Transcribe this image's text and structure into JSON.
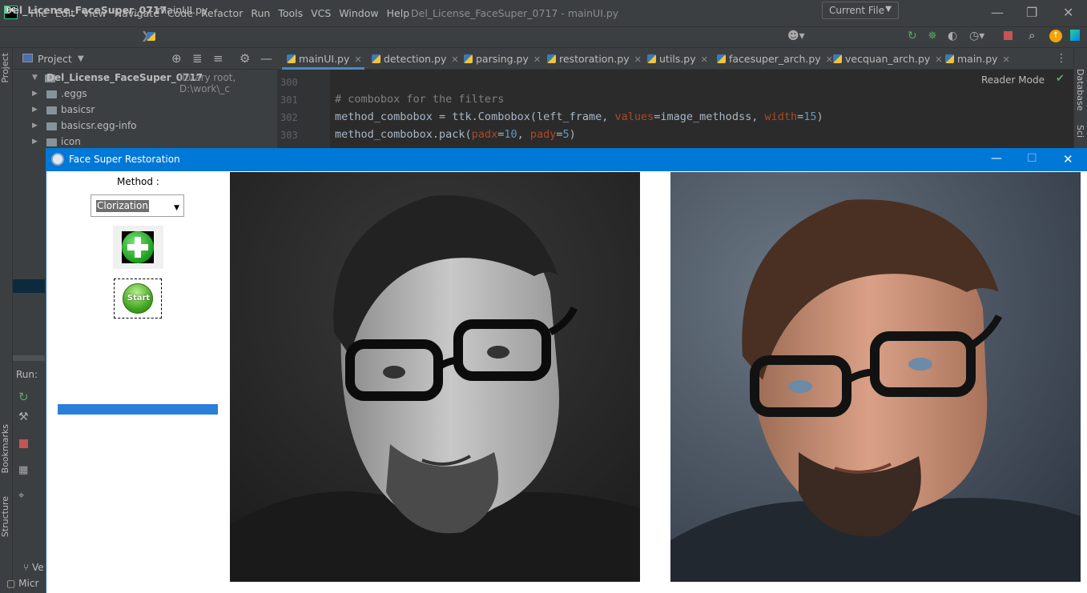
{
  "ide": {
    "window_title": "Del_License_FaceSuper_0717 - mainUI.py",
    "menus": [
      "File",
      "Edit",
      "View",
      "Navigate",
      "Code",
      "Refactor",
      "Run",
      "Tools",
      "VCS",
      "Window",
      "Help"
    ],
    "breadcrumb_project": "Del_License_FaceSuper_0717",
    "breadcrumb_file": "mainUI.py",
    "run_config": "Current File",
    "project_label": "Project",
    "project_root": "Del_License_FaceSuper_0717",
    "project_root_note": "library root,  D:\\work\\_c",
    "tree_items": [
      ".eggs",
      "basicsr",
      "basicsr.egg-info",
      "icon"
    ],
    "tabs": [
      "mainUI.py",
      "detection.py",
      "parsing.py",
      "restoration.py",
      "utils.py",
      "facesuper_arch.py",
      "vecquan_arch.py",
      "main.py"
    ],
    "reader_mode": "Reader Mode",
    "line_numbers": [
      "300",
      "301",
      "302",
      "303"
    ],
    "code": {
      "comment": "# combobox for the filters",
      "line302_a": "method_combobox = ttk.Combobox(left_frame, ",
      "line302_kw1": "values",
      "line302_b": "=image_methodss, ",
      "line302_kw2": "width",
      "line302_c": "=",
      "line302_num": "15",
      "line302_d": ")",
      "line303_a": "method_combobox.pack(",
      "line303_kw1": "padx",
      "line303_b": "=",
      "line303_num1": "10",
      "line303_c": ", ",
      "line303_kw2": "pady",
      "line303_d": "=",
      "line303_num2": "5",
      "line303_e": ")"
    },
    "run_label": "Run:",
    "side_labels": {
      "project": "Project",
      "bookmarks": "Bookmarks",
      "structure": "Structure",
      "database": "Database",
      "sci": "Sci"
    },
    "bottom_left": [
      "Ve",
      "Micr"
    ]
  },
  "app": {
    "title": "Face Super Restoration",
    "method_label": "Method :",
    "method_value": "Clorization",
    "start_label": "Start",
    "progress": 1.0,
    "colors": {
      "titlebar": "#0078d7",
      "progress": "#2a7fd9"
    }
  }
}
